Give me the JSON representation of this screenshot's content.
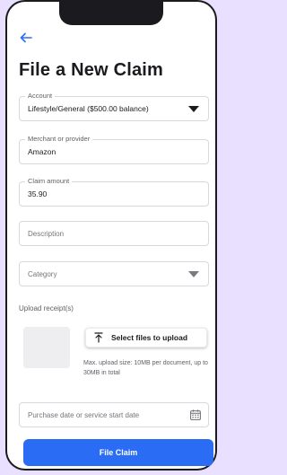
{
  "header": {
    "title": "File a New Claim"
  },
  "form": {
    "account": {
      "label": "Account",
      "value": "Lifestyle/General ($500.00 balance)"
    },
    "merchant": {
      "label": "Merchant or provider",
      "value": "Amazon"
    },
    "amount": {
      "label": "Claim amount",
      "value": "35.90"
    },
    "description": {
      "placeholder": "Description"
    },
    "category": {
      "placeholder": "Category"
    },
    "upload": {
      "label": "Upload receipt(s)",
      "button_label": "Select files to upload",
      "info": "Max. upload size: 10MB per document, up to 30MB in total"
    },
    "date": {
      "placeholder": "Purchase date or service start date"
    },
    "submit_label": "File Claim"
  },
  "colors": {
    "accent": "#2a6df4",
    "background": "#e9e0ff"
  },
  "icons": {
    "back": "arrow-left-icon",
    "caret": "caret-down-icon",
    "upload": "upload-icon",
    "calendar": "calendar-icon"
  }
}
